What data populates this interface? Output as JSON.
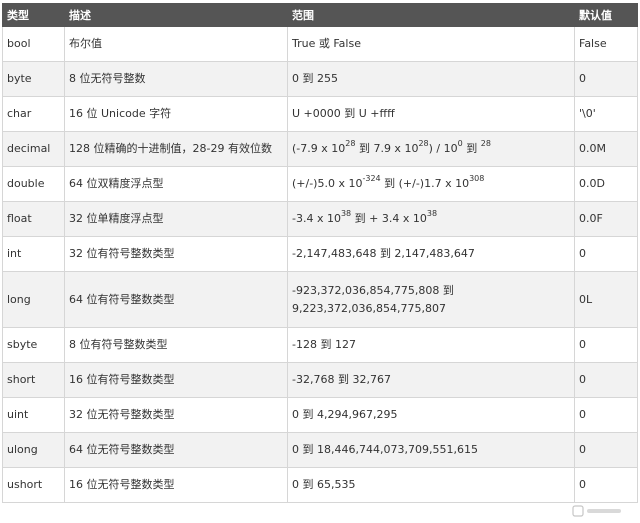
{
  "header": {
    "type": "类型",
    "desc": "描述",
    "range": "范围",
    "default": "默认值"
  },
  "rows": [
    {
      "type": "bool",
      "desc": "布尔值",
      "range": "True 或 False",
      "default": "False"
    },
    {
      "type": "byte",
      "desc": "8 位无符号整数",
      "range": "0 到 255",
      "default": "0"
    },
    {
      "type": "char",
      "desc": "16 位 Unicode 字符",
      "range": "U +0000 到 U +ffff",
      "default": "'\\0'"
    },
    {
      "type": "decimal",
      "desc": "128 位精确的十进制值，28-29 有效位数",
      "range": "(-7.9 x 10²⁸ 到 7.9 x 10²⁸) / 10⁰ 到 ²⁸",
      "default": "0.0M"
    },
    {
      "type": "double",
      "desc": "64 位双精度浮点型",
      "range": "(+/-)5.0 x 10⁻³²⁴ 到 (+/-)1.7 x 10³⁰⁸",
      "default": "0.0D"
    },
    {
      "type": "float",
      "desc": "32 位单精度浮点型",
      "range": "-3.4 x 10³⁸ 到 + 3.4 x 10³⁸",
      "default": "0.0F"
    },
    {
      "type": "int",
      "desc": "32 位有符号整数类型",
      "range": "-2,147,483,648 到 2,147,483,647",
      "default": "0"
    },
    {
      "type": "long",
      "desc": "64 位有符号整数类型",
      "range": "-923,372,036,854,775,808 到 9,223,372,036,854,775,807",
      "default": "0L"
    },
    {
      "type": "sbyte",
      "desc": "8 位有符号整数类型",
      "range": "-128 到 127",
      "default": "0"
    },
    {
      "type": "short",
      "desc": "16 位有符号整数类型",
      "range": "-32,768 到 32,767",
      "default": "0"
    },
    {
      "type": "uint",
      "desc": "32 位无符号整数类型",
      "range": "0 到 4,294,967,295",
      "default": "0"
    },
    {
      "type": "ulong",
      "desc": "64 位无符号整数类型",
      "range": "0 到 18,446,744,073,709,551,615",
      "default": "0"
    },
    {
      "type": "ushort",
      "desc": "16 位无符号整数类型",
      "range": "0 到 65,535",
      "default": "0"
    }
  ],
  "range_parts": {
    "decimal": {
      "a": "(-7.9 x 10",
      "e1": "28",
      "b": " 到 7.9 x 10",
      "e2": "28",
      "c": ") / 10",
      "e3": "0",
      "d": " 到 ",
      "e4": "28"
    },
    "double": {
      "a": "(+/-)5.0 x 10",
      "e1": "-324",
      "b": " 到 (+/-)1.7 x 10",
      "e2": "308"
    },
    "float": {
      "a": "-3.4 x 10",
      "e1": "38",
      "b": " 到 + 3.4 x 10",
      "e2": "38"
    },
    "long": {
      "line1": "-923,372,036,854,775,808 到",
      "line2": "9,223,372,036,854,775,807"
    }
  }
}
